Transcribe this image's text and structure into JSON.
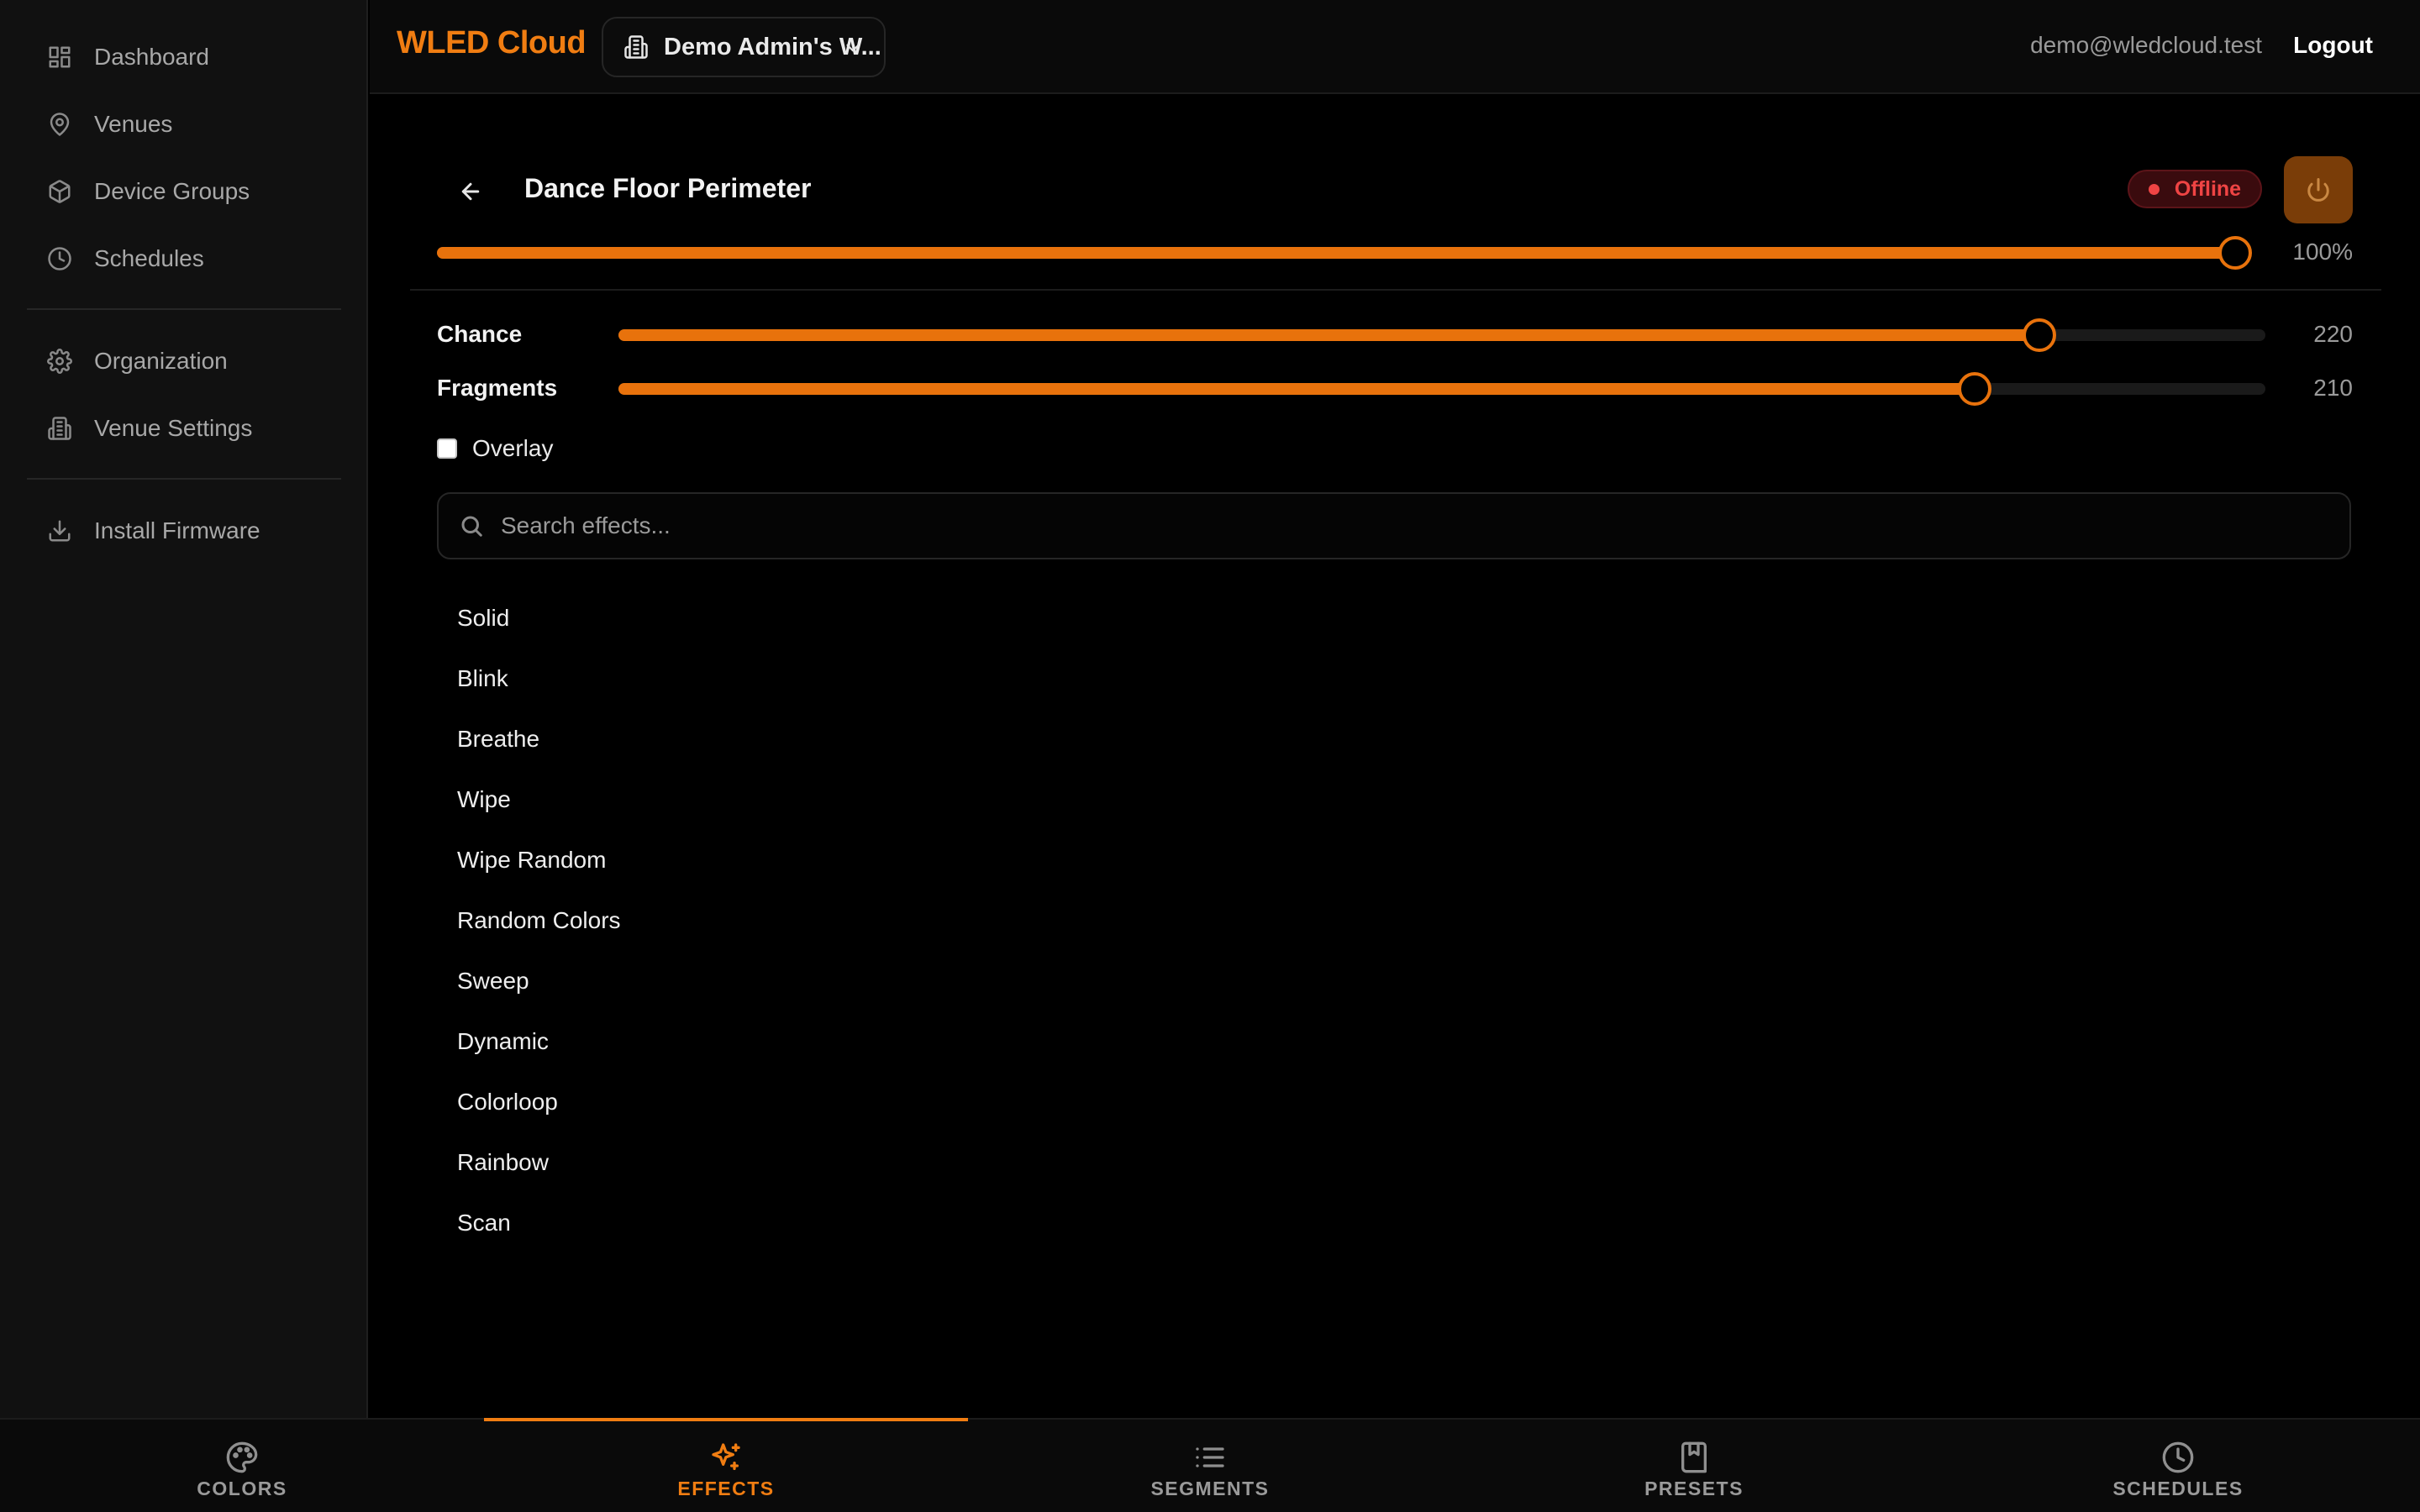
{
  "sidebar": {
    "items": [
      {
        "label": "Dashboard",
        "icon": "dashboard-icon"
      },
      {
        "label": "Venues",
        "icon": "map-pin-icon"
      },
      {
        "label": "Device Groups",
        "icon": "box-icon"
      },
      {
        "label": "Schedules",
        "icon": "clock-icon"
      },
      {
        "label": "Organization",
        "icon": "gear-icon"
      },
      {
        "label": "Venue Settings",
        "icon": "building-icon"
      },
      {
        "label": "Install Firmware",
        "icon": "download-icon"
      }
    ]
  },
  "header": {
    "brand": "WLED Cloud",
    "workspace": "Demo Admin's W...",
    "user_email": "demo@wledcloud.test",
    "logout_label": "Logout"
  },
  "device": {
    "title": "Dance Floor Perimeter",
    "status": "Offline",
    "brightness_value": "100%",
    "brightness_fraction": 1.0
  },
  "effect_params": {
    "chance": {
      "label": "Chance",
      "value": "220",
      "level": 220,
      "max": 255
    },
    "fragments": {
      "label": "Fragments",
      "value": "210",
      "level": 210,
      "max": 255
    },
    "overlay_label": "Overlay",
    "overlay_checked": false
  },
  "search": {
    "placeholder": "Search effects..."
  },
  "effects": [
    "Solid",
    "Blink",
    "Breathe",
    "Wipe",
    "Wipe Random",
    "Random Colors",
    "Sweep",
    "Dynamic",
    "Colorloop",
    "Rainbow",
    "Scan"
  ],
  "tabs": [
    {
      "label": "COLORS",
      "icon": "palette-icon",
      "active": false
    },
    {
      "label": "EFFECTS",
      "icon": "sparkles-icon",
      "active": true
    },
    {
      "label": "SEGMENTS",
      "icon": "list-icon",
      "active": false
    },
    {
      "label": "PRESETS",
      "icon": "bookmark-icon",
      "active": false
    },
    {
      "label": "SCHEDULES",
      "icon": "clock-icon",
      "active": false
    }
  ],
  "colors": {
    "accent": "#f07d12",
    "offline": "#ef4444"
  }
}
